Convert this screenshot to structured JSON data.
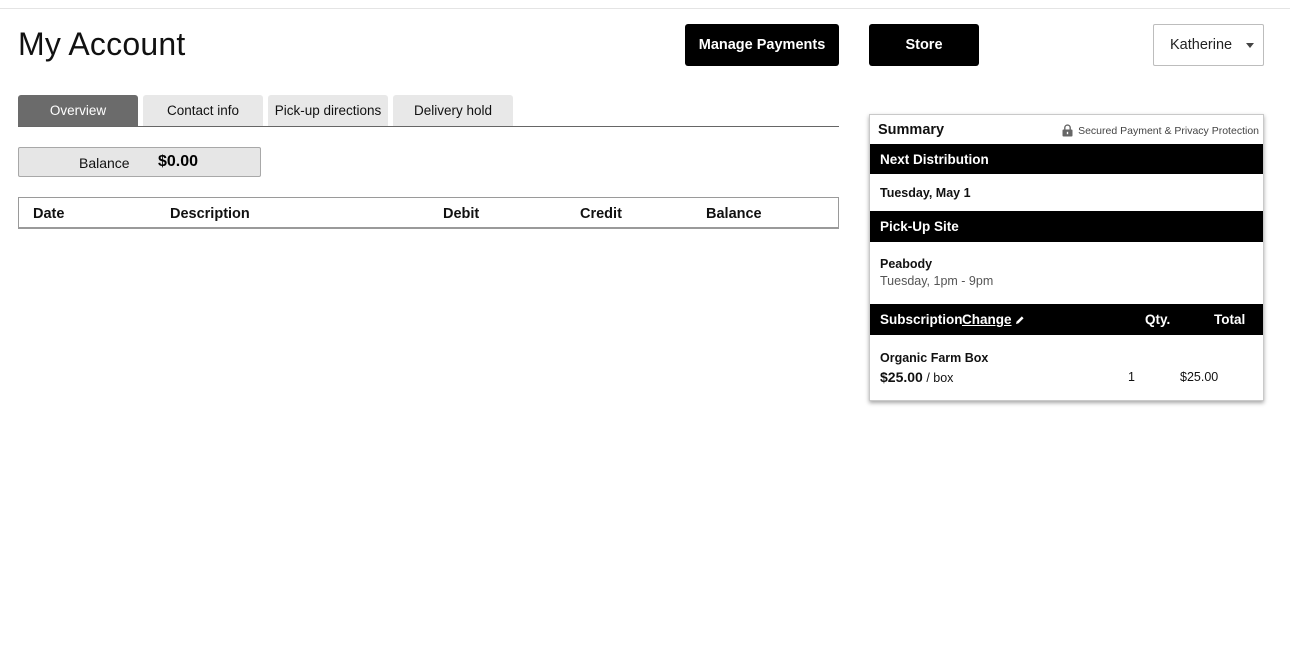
{
  "header": {
    "title": "My Account",
    "manage_payments_label": "Manage Payments",
    "store_label": "Store",
    "user_name": "Katherine"
  },
  "tabs": [
    {
      "label": "Overview",
      "active": true
    },
    {
      "label": "Contact info",
      "active": false
    },
    {
      "label": "Pick-up directions",
      "active": false
    },
    {
      "label": "Delivery hold",
      "active": false
    }
  ],
  "balance": {
    "label": "Balance",
    "value": "$0.00"
  },
  "ledger": {
    "columns": [
      "Date",
      "Description",
      "Debit",
      "Credit",
      "Balance"
    ],
    "rows": []
  },
  "summary": {
    "title": "Summary",
    "secure_text": "Secured Payment & Privacy Protection",
    "next_distribution_label": "Next Distribution",
    "next_distribution_date": "Tuesday, May 1",
    "pickup_site_label": "Pick-Up Site",
    "pickup_site_name": "Peabody",
    "pickup_site_hours": "Tuesday, 1pm - 9pm",
    "subscription_label": "Subscription",
    "change_label": "Change",
    "qty_label": "Qty.",
    "total_label": "Total",
    "item": {
      "name": "Organic Farm Box",
      "price": "$25.00",
      "unit": "/ box",
      "qty": "1",
      "total": "$25.00"
    }
  },
  "colors": {
    "primary_button": "#000000",
    "active_tab": "#6b6b6b",
    "inactive_tab": "#e8e8e8"
  }
}
